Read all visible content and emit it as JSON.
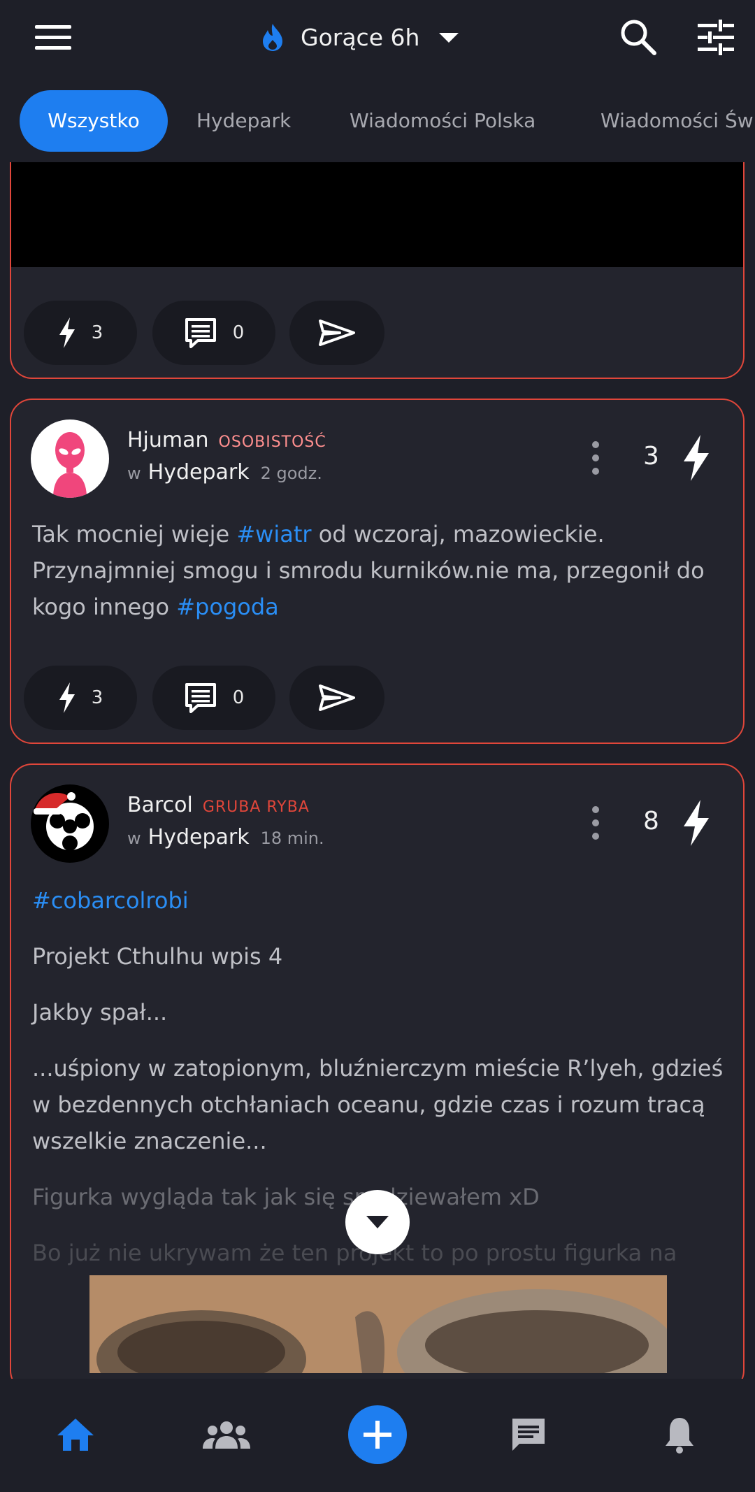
{
  "header": {
    "sort_label": "Gorące 6h",
    "icons": [
      "menu-icon",
      "flame-icon",
      "dropdown-arrow-icon",
      "search-icon",
      "filter-sliders-icon"
    ]
  },
  "tabs": [
    {
      "label": "Wszystko",
      "active": true
    },
    {
      "label": "Hydepark",
      "active": false
    },
    {
      "label": "Wiadomości Polska",
      "active": false
    },
    {
      "label": "Wiadomości Św",
      "active": false
    }
  ],
  "posts": [
    {
      "actions": {
        "votes": "3",
        "comments": "0"
      }
    },
    {
      "author": "Hjuman",
      "badge": "OSOBISTOŚĆ",
      "badge_color": "#ff8f8f",
      "in_label": "w",
      "community": "Hydepark",
      "time": "2 godz.",
      "score": "3",
      "text_before": "Tak mocniej wieje ",
      "tag1": "#wiatr",
      "text_middle": " od wczoraj, mazowieckie. Przynajmniej smogu i smrodu kurników.nie ma, przegonił do kogo innego ",
      "tag2": "#pogoda",
      "actions": {
        "votes": "3",
        "comments": "0"
      }
    },
    {
      "author": "Barcol",
      "badge": "GRUBA RYBA",
      "badge_color": "#e0463a",
      "in_label": "w",
      "community": "Hydepark",
      "time": "18 min.",
      "score": "8",
      "hashtag": "#cobarcolrobi",
      "line1": "Projekt Cthulhu wpis 4",
      "line2": "Jakby spał...",
      "line3": "...uśpiony w zatopionym, bluźnierczym mieście R’lyeh, gdzieś w bezdennych otchłaniach oceanu, gdzie czas i rozum tracą wszelkie znaczenie...",
      "line4": "Figurka wygląda tak jak się spodziewałem xD",
      "line5": "Bo już nie ukrywam że ten projekt to po prostu figurka na"
    }
  ],
  "bottom_nav": [
    "home-icon",
    "groups-icon",
    "add-icon",
    "messages-icon",
    "notifications-icon"
  ],
  "colors": {
    "accent": "#1e7ef0",
    "card_border": "#e0463a",
    "background": "#1e1f28",
    "hashtag": "#2a8ef5"
  }
}
